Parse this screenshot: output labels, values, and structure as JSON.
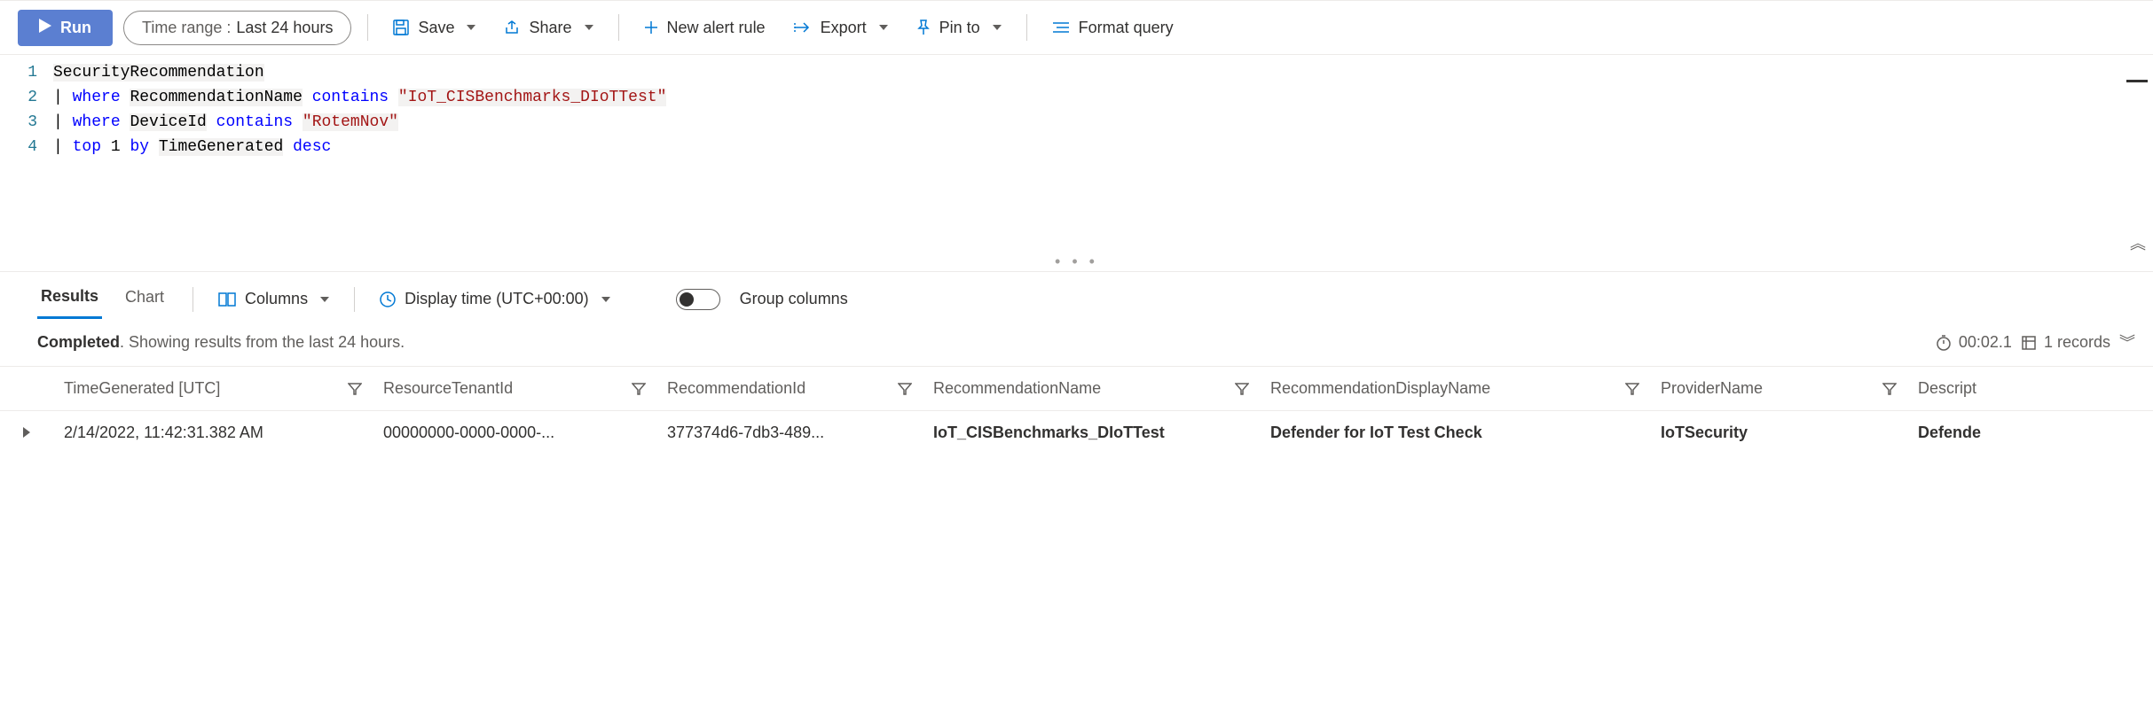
{
  "toolbar": {
    "run_label": "Run",
    "time_range_prefix": "Time range :",
    "time_range_value": "Last 24 hours",
    "save_label": "Save",
    "share_label": "Share",
    "new_alert_label": "New alert rule",
    "export_label": "Export",
    "pin_label": "Pin to",
    "format_label": "Format query"
  },
  "editor": {
    "lines": [
      "1",
      "2",
      "3",
      "4"
    ],
    "line1_table": "SecurityRecommendation",
    "line2_kw1": "where",
    "line2_col": "RecommendationName",
    "line2_kw2": "contains",
    "line2_str": "\"IoT_CISBenchmarks_DIoTTest\"",
    "line3_kw1": "where",
    "line3_col": "DeviceId",
    "line3_kw2": "contains",
    "line3_str": "\"RotemNov\"",
    "line4_kw1": "top",
    "line4_num": "1",
    "line4_kw2": "by",
    "line4_col": "TimeGenerated",
    "line4_kw3": "desc"
  },
  "results_bar": {
    "tab_results": "Results",
    "tab_chart": "Chart",
    "columns_label": "Columns",
    "display_time_label": "Display time (UTC+00:00)",
    "group_columns_label": "Group columns"
  },
  "status": {
    "completed": "Completed",
    "text_rest": ". Showing results from the last 24 hours.",
    "elapsed": "00:02.1",
    "records": "1 records"
  },
  "table": {
    "headers": {
      "time": "TimeGenerated [UTC]",
      "tenant": "ResourceTenantId",
      "recid": "RecommendationId",
      "recname": "RecommendationName",
      "recdisplay": "RecommendationDisplayName",
      "provider": "ProviderName",
      "descript": "Descript"
    },
    "row": {
      "time": "2/14/2022, 11:42:31.382 AM",
      "tenant": "00000000-0000-0000-...",
      "recid": "377374d6-7db3-489...",
      "recname": "IoT_CISBenchmarks_DIoTTest",
      "recdisplay": "Defender for IoT Test Check",
      "provider": "IoTSecurity",
      "descript": "Defende"
    }
  }
}
